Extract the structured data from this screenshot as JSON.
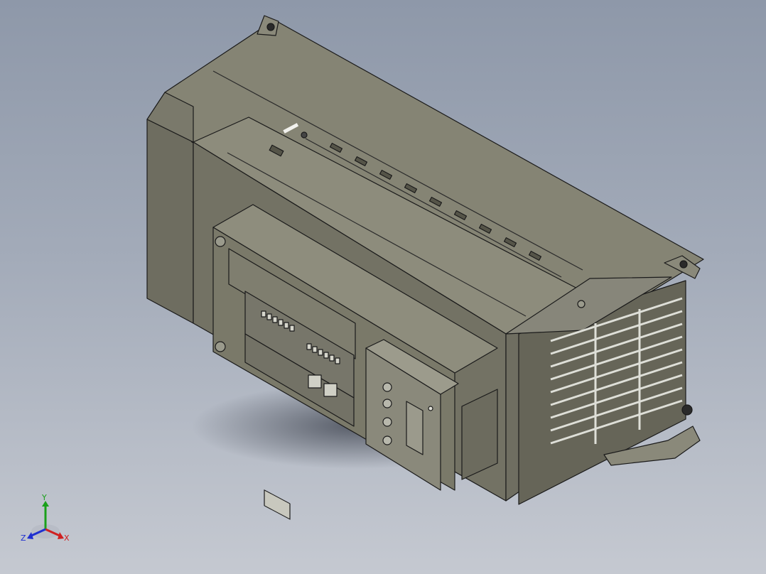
{
  "viewport": {
    "background_top": "#8e98a9",
    "background_bottom": "#c5c9d1"
  },
  "model": {
    "body_color": "#7e7d6e",
    "edge_color": "#1a1a1a"
  },
  "triad": {
    "x_label": "X",
    "y_label": "Y",
    "z_label": "Z",
    "x_color": "#d02020",
    "y_color": "#1aa01a",
    "z_color": "#1f2fd0"
  }
}
